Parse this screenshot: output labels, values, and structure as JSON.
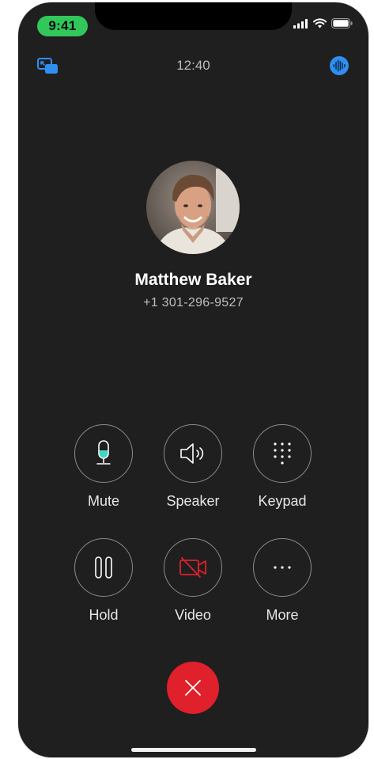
{
  "status_bar": {
    "time": "9:41",
    "signal_icon": "cellular-signal-icon",
    "wifi_icon": "wifi-icon",
    "battery_icon": "battery-icon"
  },
  "call": {
    "elapsed": "12:40",
    "caller_name": "Matthew Baker",
    "caller_number": "+1 301-296-9527",
    "pip_icon": "picture-in-picture-icon",
    "audio_icon": "audio-waveform-icon"
  },
  "controls": [
    {
      "label": "Mute",
      "icon": "microphone-icon"
    },
    {
      "label": "Speaker",
      "icon": "speaker-icon"
    },
    {
      "label": "Keypad",
      "icon": "keypad-icon"
    },
    {
      "label": "Hold",
      "icon": "pause-icon"
    },
    {
      "label": "Video",
      "icon": "video-off-icon"
    },
    {
      "label": "More",
      "icon": "more-icon"
    }
  ],
  "end_call": {
    "icon": "close-icon"
  },
  "colors": {
    "background": "#1f1f1f",
    "accent_blue": "#2f8ff0",
    "status_green": "#31c75a",
    "end_call_red": "#e0202b",
    "mute_green": "#3fd8c0",
    "video_red": "#e0202b"
  }
}
